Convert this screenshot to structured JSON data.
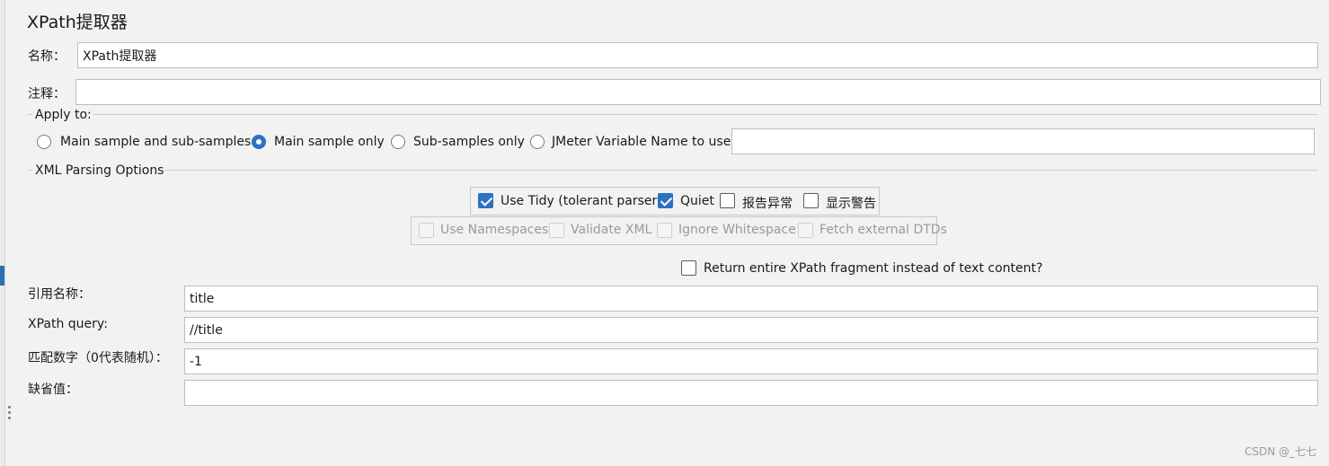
{
  "panel": {
    "title": "XPath提取器"
  },
  "name_field": {
    "label": "名称：",
    "value": "XPath提取器"
  },
  "comment_field": {
    "label": "注释：",
    "value": ""
  },
  "apply_to": {
    "legend": "Apply to:",
    "options": [
      {
        "label": "Main sample and sub-samples",
        "selected": false
      },
      {
        "label": "Main sample only",
        "selected": true
      },
      {
        "label": "Sub-samples only",
        "selected": false
      },
      {
        "label": "JMeter Variable Name to use",
        "selected": false
      }
    ],
    "variable_name_value": ""
  },
  "xml_options": {
    "legend": "XML Parsing Options",
    "row1": [
      {
        "label": "Use Tidy (tolerant parser)",
        "checked": true
      },
      {
        "label": "Quiet",
        "checked": true
      },
      {
        "label": "报告异常",
        "checked": false
      },
      {
        "label": "显示警告",
        "checked": false
      }
    ],
    "row2": [
      {
        "label": "Use Namespaces",
        "checked": false,
        "disabled": true
      },
      {
        "label": "Validate XML",
        "checked": false,
        "disabled": true
      },
      {
        "label": "Ignore Whitespace",
        "checked": false,
        "disabled": true
      },
      {
        "label": "Fetch external DTDs",
        "checked": false,
        "disabled": true
      }
    ]
  },
  "return_fragment": {
    "label": "Return entire XPath fragment instead of text content?",
    "checked": false
  },
  "fields": {
    "ref_name": {
      "label": "引用名称：",
      "value": "title"
    },
    "xpath_query": {
      "label": "XPath query:",
      "value": "//title"
    },
    "match_no": {
      "label": "匹配数字（0代表随机）：",
      "value": "-1"
    },
    "default_value": {
      "label": "缺省值：",
      "value": ""
    }
  },
  "watermark": "CSDN @_七七"
}
